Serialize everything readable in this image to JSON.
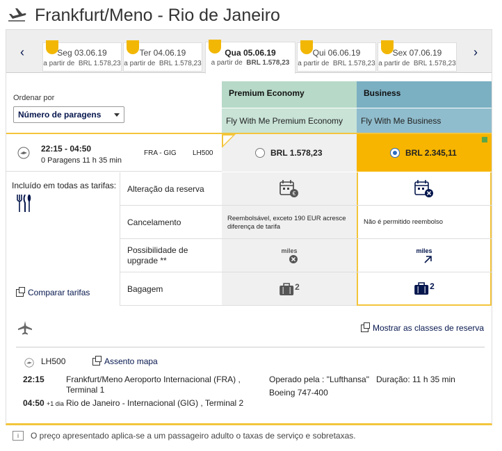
{
  "header": {
    "title": "Frankfurt/Meno - Rio de Janeiro",
    "icon": "plane-departure-icon"
  },
  "dates": [
    {
      "day": "Seg 03.06.19",
      "prefix": "a partir de",
      "price": "BRL 1.578,23",
      "active": false
    },
    {
      "day": "Ter 04.06.19",
      "prefix": "a partir de",
      "price": "BRL 1.578,23",
      "active": false
    },
    {
      "day": "Qua 05.06.19",
      "prefix": "a partir de",
      "price": "BRL 1.578,23",
      "active": true
    },
    {
      "day": "Qui 06.06.19",
      "prefix": "a partir de",
      "price": "BRL 1.578,23",
      "active": false
    },
    {
      "day": "Sex 07.06.19",
      "prefix": "a partir de",
      "price": "BRL 1.578,23",
      "active": false
    }
  ],
  "sort": {
    "label": "Ordenar por",
    "value": "Número de paragens"
  },
  "cabins": {
    "premium": {
      "name": "Premium Economy",
      "fare": "Fly With Me Premium Economy",
      "color": "#b7d9c8"
    },
    "business": {
      "name": "Business",
      "fare": "Fly With Me Business",
      "color": "#7bafc2"
    }
  },
  "flight": {
    "time": "22:15 - 04:50",
    "stops": "0 Paragens 11 h 35 min",
    "route": "FRA - GIG",
    "number": "LH500",
    "premium_price": "BRL 1.578,23",
    "business_price": "BRL 2.345,11",
    "selected": "business"
  },
  "included": {
    "title": "Incluído em todas as tarifas:",
    "compare": "Comparar tarifas"
  },
  "features": [
    {
      "label": "Alteração da reserva"
    },
    {
      "label": "Cancelamento",
      "premium": "Reembolsável, exceto 190 EUR acresce diferença de tarifa",
      "business": "Não é permitido reembolso"
    },
    {
      "label": "Possibilidade de upgrade **",
      "miles": "miles"
    },
    {
      "label": "Bagagem",
      "bags": "2"
    }
  ],
  "details": {
    "show_classes": "Mostrar as classes de reserva",
    "flight_number": "LH500",
    "seat_map": "Assento mapa",
    "dep_time": "22:15",
    "dep_place": "Frankfurt/Meno Aeroporto Internacional (FRA) , Terminal 1",
    "operated_by": "Operado pela : \"Lufthansa\"",
    "duration": "Duração: 11 h 35 min",
    "aircraft": "Boeing 747-400",
    "arr_time": "04:50",
    "arr_plus": "+1 dia",
    "arr_place": "Rio de Janeiro - Internacional (GIG) , Terminal 2"
  },
  "footer": {
    "info": "i",
    "text": "O preço apresentado aplica-se a um passageiro adulto o taxas de serviço e sobretaxas."
  }
}
